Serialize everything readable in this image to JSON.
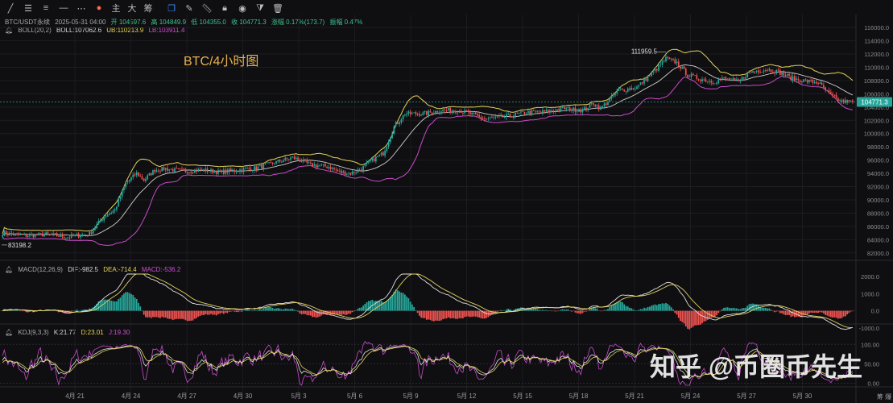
{
  "toolbar": {
    "icons": [
      "draw-line-icon",
      "horizontal-lines-icon",
      "vertical-lines-icon",
      "dash-line-icon",
      "more-icon",
      "color-dot-icon"
    ],
    "labels": {
      "main": "主",
      "big": "大",
      "chip": "筹"
    },
    "right_icons": [
      "copy-icon",
      "pencil-icon",
      "ruler-icon",
      "lock-icon",
      "eye-icon",
      "filter-icon",
      "trash-icon"
    ]
  },
  "header": {
    "symbol": "BTC/USDT永续",
    "datetime": "2025-05-31 04:00",
    "open": "开 104597.6",
    "high": "高 104849.9",
    "low": "低 104355.0",
    "close": "收 104771.3",
    "change": "涨幅 0.17%(173.7)",
    "amplitude": "振幅 0.47%"
  },
  "boll": {
    "name": "BOLL(20,2)",
    "mid": "BOLL:107062.6",
    "ub": "UB:110213.9",
    "lb": "LB:103911.4"
  },
  "macd": {
    "name": "MACD(12,26,9)",
    "dif": "DIF:-982.5",
    "dea": "DEA:-714.4",
    "macd": "MACD:-536.2"
  },
  "kdj": {
    "name": "KDJ(9,3,3)",
    "k": "K:21.77",
    "d": "D:23.01",
    "j": "J:19.30"
  },
  "overlay_title": "BTC/4小时图",
  "watermark": "知乎 @币圈币先生",
  "axis_corner": "筹 爆",
  "colors": {
    "up": "#26a69a",
    "down": "#ef5350",
    "boll_mid": "#cfcfcf",
    "boll_ub": "#e3d35a",
    "boll_lb": "#c94bc9",
    "macd_dif": "#e0e0e0",
    "macd_dea": "#e3d35a",
    "kdj_k": "#e0e0e0",
    "kdj_d": "#e3d35a",
    "kdj_j": "#c94bc9",
    "price_tag": "#26a69a"
  },
  "chart_data": [
    {
      "type": "candlestick",
      "title": "BTC/4小时图",
      "x_ticks": [
        "4月 21",
        "4月 24",
        "4月 27",
        "4月 30",
        "5月 3",
        "5月 6",
        "5月 9",
        "5月 12",
        "5月 15",
        "5月 18",
        "5月 21",
        "5月 24",
        "5月 27",
        "5月 30"
      ],
      "y_ticks": [
        82000,
        84000,
        86000,
        88000,
        90000,
        92000,
        94000,
        96000,
        98000,
        100000,
        102000,
        104000,
        106000,
        108000,
        110000,
        112000,
        114000,
        116000
      ],
      "ylim": [
        81000,
        116500
      ],
      "current_price": 104771.3,
      "annotations": [
        {
          "label": "111959.5",
          "value": 111959.5
        },
        {
          "label": "83198.2",
          "value": 83198.2
        }
      ],
      "close_keypoints": [
        [
          0,
          85000
        ],
        [
          12,
          84600
        ],
        [
          24,
          84800
        ],
        [
          36,
          84400
        ],
        [
          48,
          84900
        ],
        [
          56,
          87500
        ],
        [
          62,
          88500
        ],
        [
          68,
          92500
        ],
        [
          74,
          94000
        ],
        [
          78,
          93000
        ],
        [
          84,
          94500
        ],
        [
          90,
          94700
        ],
        [
          100,
          94300
        ],
        [
          110,
          94500
        ],
        [
          120,
          94200
        ],
        [
          130,
          94500
        ],
        [
          140,
          94800
        ],
        [
          150,
          95600
        ],
        [
          160,
          96400
        ],
        [
          170,
          95300
        ],
        [
          180,
          95000
        ],
        [
          186,
          94200
        ],
        [
          192,
          94000
        ],
        [
          198,
          94700
        ],
        [
          204,
          96000
        ],
        [
          210,
          97000
        ],
        [
          216,
          101000
        ],
        [
          222,
          103000
        ],
        [
          232,
          103000
        ],
        [
          242,
          103500
        ],
        [
          252,
          103500
        ],
        [
          260,
          102800
        ],
        [
          266,
          102200
        ],
        [
          276,
          102500
        ],
        [
          290,
          103200
        ],
        [
          300,
          103300
        ],
        [
          310,
          103800
        ],
        [
          320,
          103500
        ],
        [
          326,
          104600
        ],
        [
          330,
          103800
        ],
        [
          340,
          106500
        ],
        [
          350,
          107000
        ],
        [
          360,
          109500
        ],
        [
          366,
          111300
        ],
        [
          372,
          110700
        ],
        [
          378,
          108800
        ],
        [
          386,
          108200
        ],
        [
          392,
          107800
        ],
        [
          398,
          108300
        ],
        [
          406,
          107800
        ],
        [
          412,
          109300
        ],
        [
          422,
          109700
        ],
        [
          428,
          109300
        ],
        [
          436,
          108300
        ],
        [
          444,
          107900
        ],
        [
          450,
          107700
        ],
        [
          456,
          106000
        ],
        [
          462,
          104900
        ],
        [
          468,
          104771.3
        ]
      ],
      "boll": {
        "ub": 110213.9,
        "mid": 107062.6,
        "lb": 103911.4
      }
    },
    {
      "type": "bar",
      "title": "MACD(12,26,9)",
      "y_ticks": [
        2000.0,
        1000.0,
        0.0,
        -1000.0
      ],
      "ylim": [
        -1150,
        2150
      ],
      "series": [
        {
          "name": "DIF",
          "last": -982.5
        },
        {
          "name": "DEA",
          "last": -714.4
        },
        {
          "name": "MACD",
          "last": -536.2
        }
      ]
    },
    {
      "type": "line",
      "title": "KDJ(9,3,3)",
      "y_ticks": [
        100,
        50,
        0
      ],
      "ylim": [
        -5,
        115
      ],
      "series": [
        {
          "name": "K",
          "last": 21.77
        },
        {
          "name": "D",
          "last": 23.01
        },
        {
          "name": "J",
          "last": 19.3
        }
      ]
    }
  ]
}
